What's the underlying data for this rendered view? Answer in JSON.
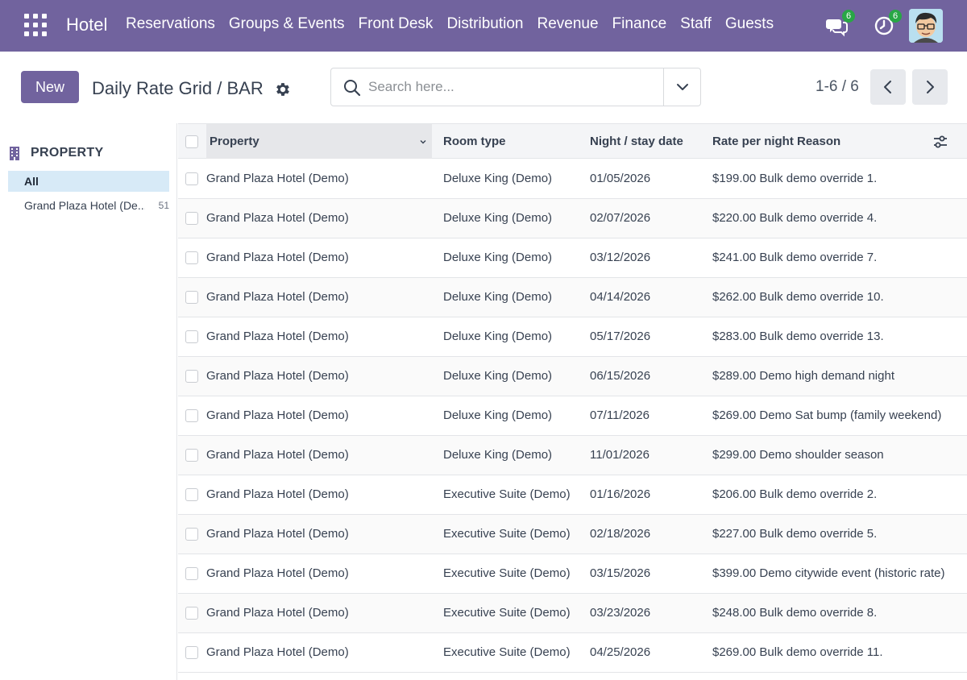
{
  "navbar": {
    "brand": "Hotel",
    "menu": [
      "Reservations",
      "Groups & Events",
      "Front Desk",
      "Distribution",
      "Revenue",
      "Finance",
      "Staff",
      "Guests"
    ],
    "messages_badge": "6",
    "activities_badge": "6",
    "accent": "#71639e"
  },
  "control": {
    "new_label": "New",
    "breadcrumb": "Daily Rate Grid / BAR",
    "search_placeholder": "Search here...",
    "pager": "1-6 / 6"
  },
  "sidebar": {
    "title": "PROPERTY",
    "items": [
      {
        "label": "All",
        "count": ""
      },
      {
        "label": "Grand Plaza Hotel (De...",
        "count": "51"
      }
    ]
  },
  "table": {
    "columns": [
      "Property",
      "Room type",
      "Night / stay date",
      "Rate per night Reason"
    ],
    "rows": [
      {
        "property": "Grand Plaza Hotel (Demo)",
        "room": "Deluxe King (Demo)",
        "date": "01/05/2026",
        "rate": "$199.00 Bulk demo override 1."
      },
      {
        "property": "Grand Plaza Hotel (Demo)",
        "room": "Deluxe King (Demo)",
        "date": "02/07/2026",
        "rate": "$220.00 Bulk demo override 4."
      },
      {
        "property": "Grand Plaza Hotel (Demo)",
        "room": "Deluxe King (Demo)",
        "date": "03/12/2026",
        "rate": "$241.00 Bulk demo override 7."
      },
      {
        "property": "Grand Plaza Hotel (Demo)",
        "room": "Deluxe King (Demo)",
        "date": "04/14/2026",
        "rate": "$262.00 Bulk demo override 10."
      },
      {
        "property": "Grand Plaza Hotel (Demo)",
        "room": "Deluxe King (Demo)",
        "date": "05/17/2026",
        "rate": "$283.00 Bulk demo override 13."
      },
      {
        "property": "Grand Plaza Hotel (Demo)",
        "room": "Deluxe King (Demo)",
        "date": "06/15/2026",
        "rate": "$289.00 Demo high demand night"
      },
      {
        "property": "Grand Plaza Hotel (Demo)",
        "room": "Deluxe King (Demo)",
        "date": "07/11/2026",
        "rate": "$269.00 Demo Sat bump (family weekend)"
      },
      {
        "property": "Grand Plaza Hotel (Demo)",
        "room": "Deluxe King (Demo)",
        "date": "11/01/2026",
        "rate": "$299.00 Demo shoulder season"
      },
      {
        "property": "Grand Plaza Hotel (Demo)",
        "room": "Executive Suite (Demo)",
        "date": "01/16/2026",
        "rate": "$206.00 Bulk demo override 2."
      },
      {
        "property": "Grand Plaza Hotel (Demo)",
        "room": "Executive Suite (Demo)",
        "date": "02/18/2026",
        "rate": "$227.00 Bulk demo override 5."
      },
      {
        "property": "Grand Plaza Hotel (Demo)",
        "room": "Executive Suite (Demo)",
        "date": "03/15/2026",
        "rate": "$399.00 Demo citywide event (historic rate)"
      },
      {
        "property": "Grand Plaza Hotel (Demo)",
        "room": "Executive Suite (Demo)",
        "date": "03/23/2026",
        "rate": "$248.00 Bulk demo override 8."
      },
      {
        "property": "Grand Plaza Hotel (Demo)",
        "room": "Executive Suite (Demo)",
        "date": "04/25/2026",
        "rate": "$269.00 Bulk demo override 11."
      }
    ]
  }
}
